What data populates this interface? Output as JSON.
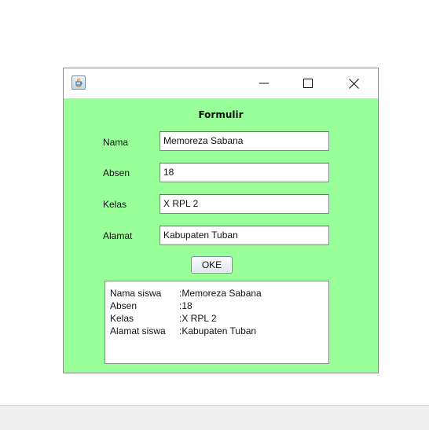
{
  "window": {
    "title": "",
    "background": "#99ff99",
    "icons": {
      "app": "java-icon",
      "minimize": "minimize-icon",
      "maximize": "maximize-icon",
      "close": "close-icon"
    }
  },
  "form": {
    "title": "Formulir",
    "fields": [
      {
        "label": "Nama",
        "value": "Memoreza Sabana"
      },
      {
        "label": "Absen",
        "value": "18"
      },
      {
        "label": "Kelas",
        "value": "X RPL 2"
      },
      {
        "label": "Alamat",
        "value": "Kabupaten Tuban"
      }
    ],
    "submit_label": "OKE"
  },
  "output": {
    "rows": [
      {
        "key": "Nama siswa",
        "value": ":Memoreza Sabana"
      },
      {
        "key": "Absen",
        "value": ":18"
      },
      {
        "key": "Kelas",
        "value": ":X RPL 2"
      },
      {
        "key": "Alamat siswa",
        "value": ":Kabupaten Tuban"
      }
    ]
  }
}
